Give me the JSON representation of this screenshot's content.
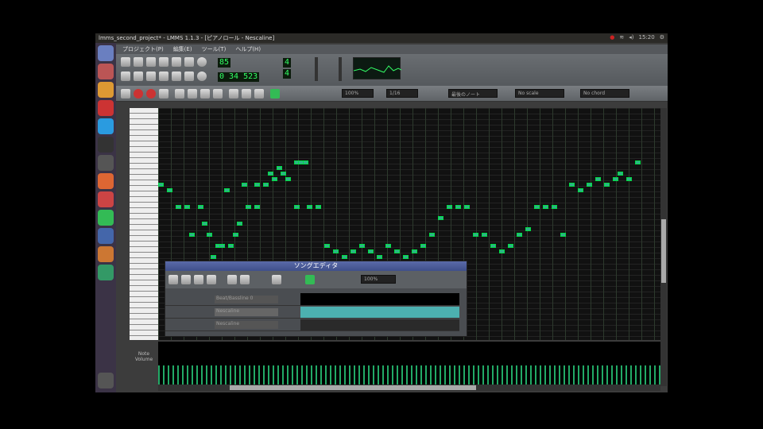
{
  "window_title": "lmms_second_project* - LMMS 1.1.3 - [ピアノロール - Nescaline]",
  "clock": "15:20",
  "menu": [
    "プロジェクト(P)",
    "編集(E)",
    "ツール(T)",
    "ヘルプ(H)"
  ],
  "tempo": "85",
  "time": {
    "min": "0",
    "sec": "34",
    "ms": "523"
  },
  "timesig": {
    "num": "4",
    "den": "4"
  },
  "piano_roll": {
    "zoom": "100%",
    "quantize": "1/16",
    "note_len": "最後のノート",
    "scale": "No scale",
    "chord": "No chord",
    "velocity_label": "Note Volume"
  },
  "song_editor": {
    "title": "ソングエディタ",
    "zoom": "100%",
    "tracks": [
      {
        "name": "Beat/Bassline 0"
      },
      {
        "name": "Nescaline"
      },
      {
        "name": "Nescaline"
      }
    ]
  },
  "colors": {
    "note": "#2fb08a",
    "grid": "#111111",
    "accent": "#3f6"
  }
}
